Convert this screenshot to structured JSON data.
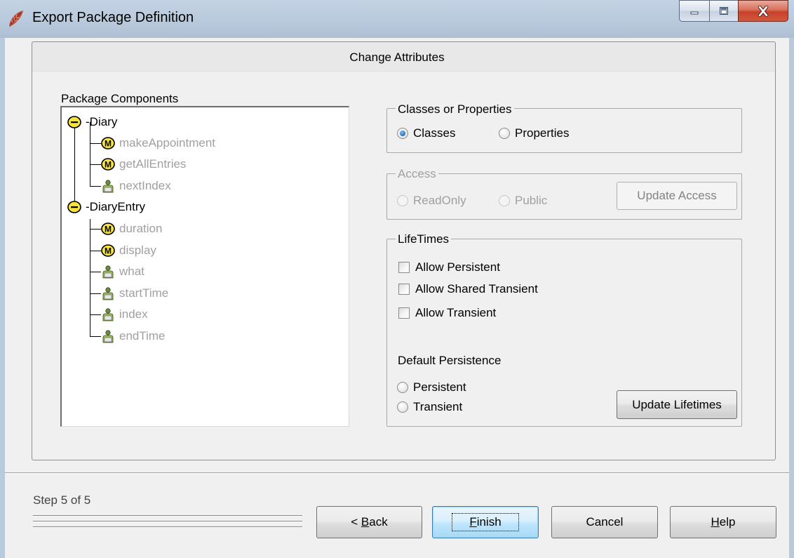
{
  "window": {
    "title": "Export Package Definition",
    "controls": [
      "minimize-icon",
      "maximize-icon",
      "close-icon"
    ]
  },
  "header": {
    "title": "Change Attributes"
  },
  "tree": {
    "label": "Package Components",
    "nodes": [
      {
        "label": "-Diary",
        "icon": "collapse-icon",
        "enabled": true,
        "children": [
          {
            "label": "makeAppointment",
            "icon": "method-icon",
            "enabled": false
          },
          {
            "label": "getAllEntries",
            "icon": "method-icon",
            "enabled": false
          },
          {
            "label": "nextIndex",
            "icon": "property-icon",
            "enabled": false
          }
        ]
      },
      {
        "label": "-DiaryEntry",
        "icon": "collapse-icon",
        "enabled": true,
        "children": [
          {
            "label": "duration",
            "icon": "method-icon",
            "enabled": false
          },
          {
            "label": "display",
            "icon": "method-icon",
            "enabled": false
          },
          {
            "label": "what",
            "icon": "property-icon",
            "enabled": false
          },
          {
            "label": "startTime",
            "icon": "property-icon",
            "enabled": false
          },
          {
            "label": "index",
            "icon": "property-icon",
            "enabled": false
          },
          {
            "label": "endTime",
            "icon": "property-icon",
            "enabled": false
          }
        ]
      }
    ],
    "method_glyph": "M"
  },
  "classes_or_properties": {
    "title": "Classes or Properties",
    "options": [
      {
        "label": "Classes",
        "checked": true
      },
      {
        "label": "Properties",
        "checked": false
      }
    ]
  },
  "access": {
    "title": "Access",
    "enabled": false,
    "options": [
      {
        "label": "ReadOnly",
        "checked": false
      },
      {
        "label": "Public",
        "checked": false
      }
    ],
    "button_label": "Update Access"
  },
  "lifetimes": {
    "title": "LifeTimes",
    "checkboxes": [
      {
        "label": "Allow Persistent",
        "checked": false
      },
      {
        "label": "Allow Shared Transient",
        "checked": false
      },
      {
        "label": "Allow Transient",
        "checked": false
      }
    ],
    "default_label": "Default Persistence",
    "default_options": [
      {
        "label": "Persistent",
        "checked": false
      },
      {
        "label": "Transient",
        "checked": false
      }
    ],
    "button_label": "Update Lifetimes"
  },
  "footer": {
    "step_text": "Step 5 of 5",
    "back": {
      "prefix": "< ",
      "mnemonic": "B",
      "rest": "ack"
    },
    "finish": {
      "mnemonic": "F",
      "rest": "inish"
    },
    "cancel": "Cancel",
    "help": {
      "mnemonic": "H",
      "rest": "elp"
    }
  },
  "colors": {
    "titlebar": "#b9cadd",
    "dialog_bg": "#f0f0f0",
    "disabled_text": "#a0a0a0",
    "close_button": "#c7422a",
    "radio_selected": "#1f6fc4",
    "method_icon": "#f7e43a"
  }
}
